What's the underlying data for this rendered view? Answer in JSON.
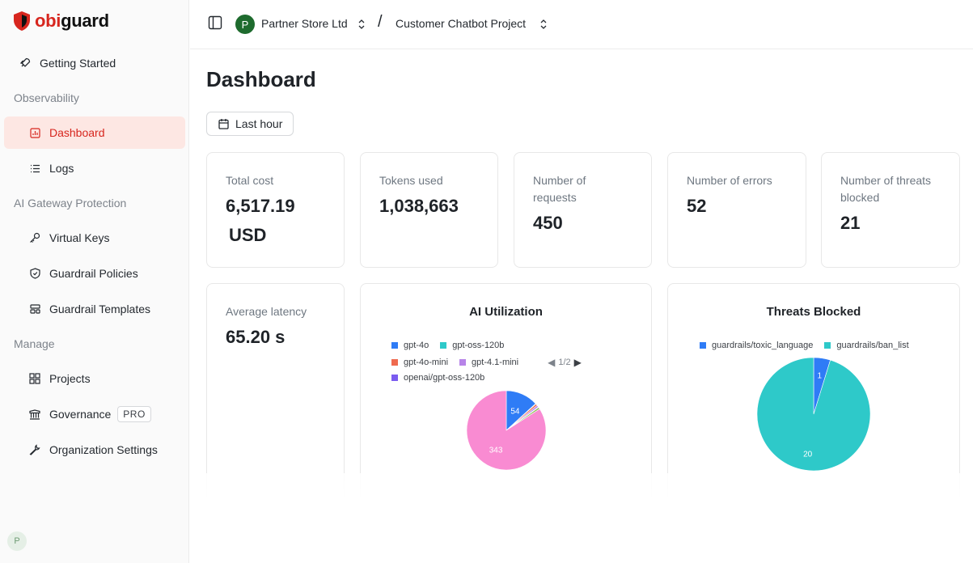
{
  "brand": {
    "prefix": "obi",
    "suffix": "guard",
    "accent": "#d7261e"
  },
  "sidebar": {
    "getting_started": "Getting Started",
    "sections": {
      "observability": "Observability",
      "protection": "AI Gateway Protection",
      "manage": "Manage"
    },
    "items": {
      "dashboard": "Dashboard",
      "logs": "Logs",
      "virtual_keys": "Virtual Keys",
      "guardrail_policies": "Guardrail Policies",
      "guardrail_templates": "Guardrail Templates",
      "projects": "Projects",
      "governance": "Governance",
      "governance_badge": "PRO",
      "org_settings": "Organization Settings"
    },
    "user_initial": "P"
  },
  "header": {
    "org_initial": "P",
    "org_name": "Partner Store Ltd",
    "separator": "/",
    "project_name": "Customer Chatbot Project"
  },
  "page": {
    "title": "Dashboard",
    "time_range": "Last hour"
  },
  "metrics": {
    "total_cost": {
      "label": "Total cost",
      "value": "6,517.19",
      "unit": "USD"
    },
    "tokens": {
      "label": "Tokens used",
      "value": "1,038,663"
    },
    "requests": {
      "label": "Number of requests",
      "value": "450"
    },
    "errors": {
      "label": "Number of errors",
      "value": "52"
    },
    "threats": {
      "label": "Number of threats blocked",
      "value": "21"
    },
    "latency": {
      "label": "Average latency",
      "value": "65.20 s"
    }
  },
  "chart_data": [
    {
      "type": "pie",
      "title": "AI Utilization",
      "legend_page": "1/2",
      "legend_placement": "top",
      "series": [
        {
          "name": "gpt-4o",
          "value": 54,
          "color": "#2f7cf6"
        },
        {
          "name": "gpt-oss-120b",
          "value": 1,
          "color": "#2ec9c9"
        },
        {
          "name": "gpt-4o-mini",
          "value": 3,
          "color": "#ef6a4f"
        },
        {
          "name": "gpt-4.1-mini",
          "value": 3,
          "color": "#b784e8"
        },
        {
          "name": "openai/gpt-oss-120b",
          "value": 1,
          "color": "#7b5cf0"
        },
        {
          "name": "",
          "value": 3,
          "color": "#8fbf5a"
        },
        {
          "name": "",
          "value": 343,
          "color": "#f98bd2"
        }
      ],
      "data_labels": [
        "54",
        "343"
      ]
    },
    {
      "type": "pie",
      "title": "Threats Blocked",
      "legend_placement": "top",
      "series": [
        {
          "name": "guardrails/toxic_language",
          "value": 1,
          "color": "#2f7cf6"
        },
        {
          "name": "guardrails/ban_list",
          "value": 20,
          "color": "#2ec9c9"
        }
      ],
      "data_labels": [
        "1",
        "20"
      ]
    }
  ]
}
